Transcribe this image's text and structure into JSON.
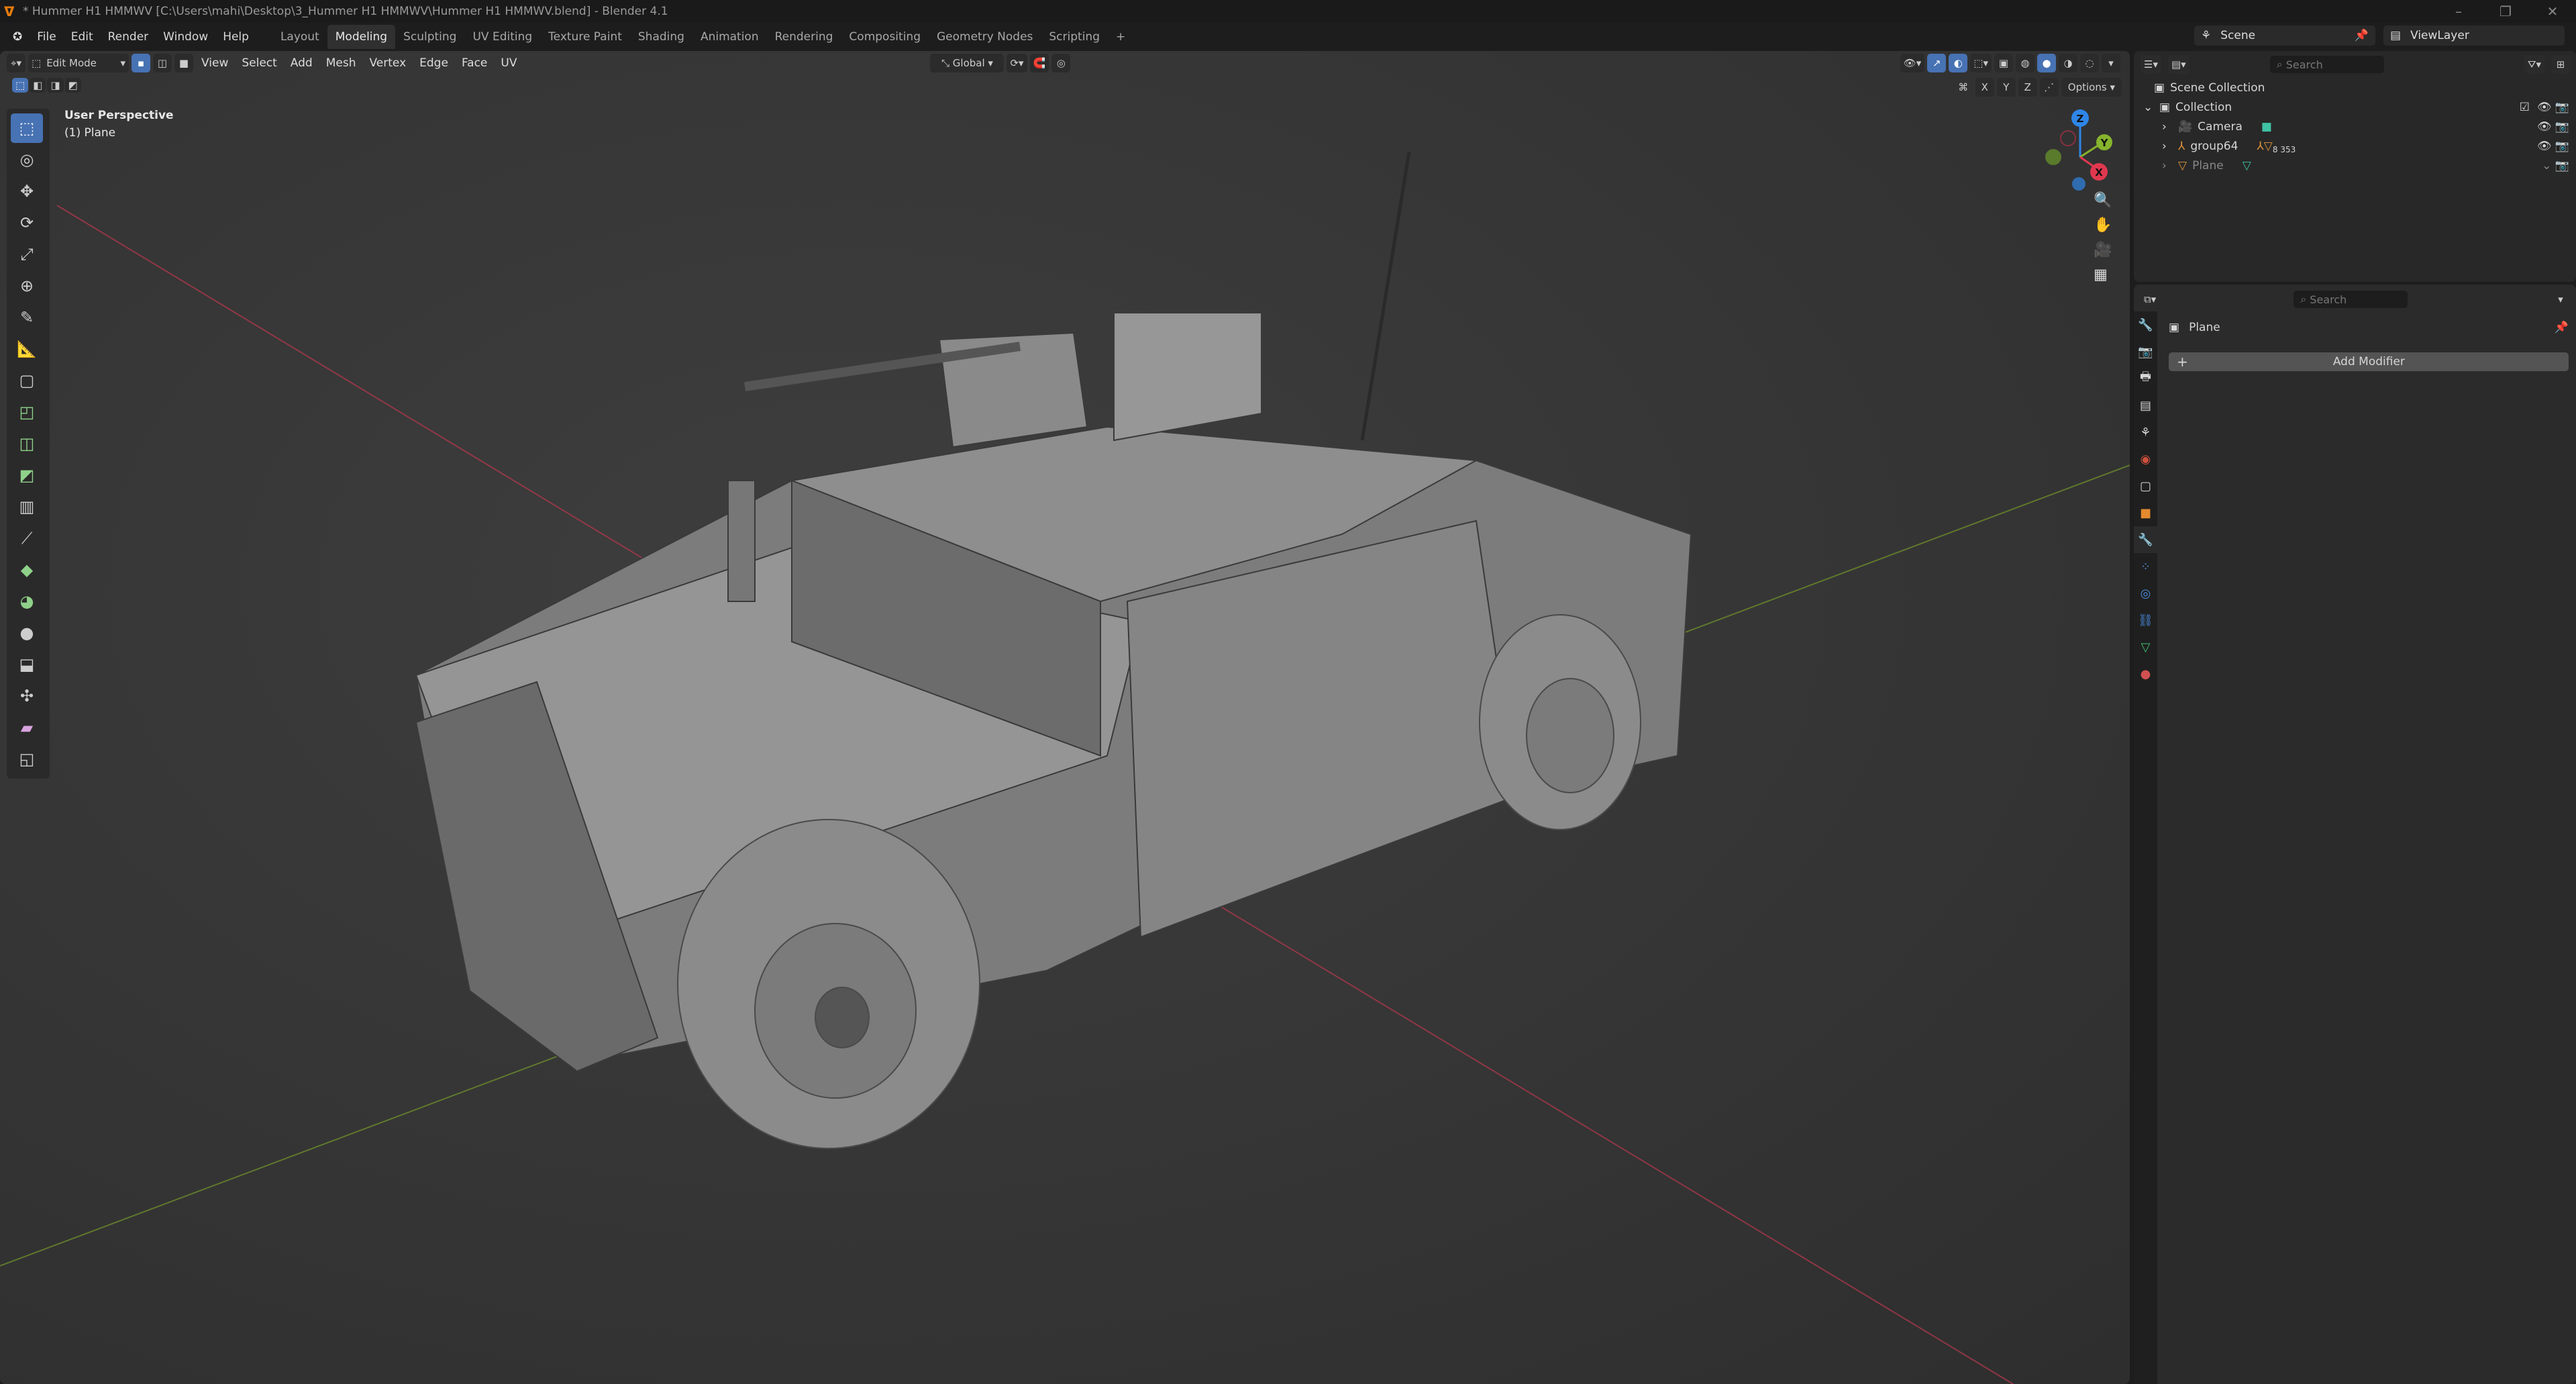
{
  "title": "* Hummer H1 HMMWV [C:\\Users\\mahi\\Desktop\\3_Hummer H1 HMMWV\\Hummer H1 HMMWV.blend] - Blender 4.1",
  "window_controls": [
    "–",
    "❐",
    "✕"
  ],
  "menu": [
    "File",
    "Edit",
    "Render",
    "Window",
    "Help"
  ],
  "workspaces": [
    "Layout",
    "Modeling",
    "Sculpting",
    "UV Editing",
    "Texture Paint",
    "Shading",
    "Animation",
    "Rendering",
    "Compositing",
    "Geometry Nodes",
    "Scripting",
    "+"
  ],
  "active_workspace": "Modeling",
  "scene": "Scene",
  "view_layer": "ViewLayer",
  "viewport": {
    "mode": "Edit Mode",
    "menus": [
      "View",
      "Select",
      "Add",
      "Mesh",
      "Vertex",
      "Edge",
      "Face",
      "UV"
    ],
    "orientation": "Global",
    "options_label": "Options",
    "axes": [
      "X",
      "Y",
      "Z"
    ],
    "overlay_line1": "User Perspective",
    "overlay_line2": "(1) Plane",
    "gizmo": {
      "x": "X",
      "y": "Y",
      "z": "Z"
    }
  },
  "tools": [
    "select-box",
    "cursor",
    "move",
    "rotate",
    "scale",
    "transform",
    "annotate",
    "measure",
    "add-cube",
    "extrude",
    "inset",
    "bevel",
    "loop-cut",
    "knife",
    "poly-build",
    "spin",
    "smooth",
    "shrink-fatten",
    "shear",
    "rip"
  ],
  "outliner": {
    "search_placeholder": "Search",
    "root": "Scene Collection",
    "collection": "Collection",
    "items": [
      {
        "name": "Camera",
        "type": "camera"
      },
      {
        "name": "group64",
        "type": "empty",
        "children_count": "8 353"
      },
      {
        "name": "Plane",
        "type": "mesh"
      }
    ]
  },
  "properties": {
    "search_placeholder": "Search",
    "object_name": "Plane",
    "add_modifier": "Add Modifier",
    "tab_colors": [
      "#aaaaaa",
      "#bbbbbb",
      "#bbbbbb",
      "#bbbbbb",
      "#c9a27a",
      "#d0503c",
      "#bbbbbb",
      "#e58a2e",
      "#4a8fe0",
      "#4a8fe0",
      "#4a8fe0",
      "#4a8fe0",
      "#3fbf6f",
      "#d05050"
    ]
  },
  "colors": {
    "accent": "#4772b3",
    "x_axis": "#e0384f",
    "y_axis": "#86b42c",
    "z_axis": "#2f86e6"
  }
}
